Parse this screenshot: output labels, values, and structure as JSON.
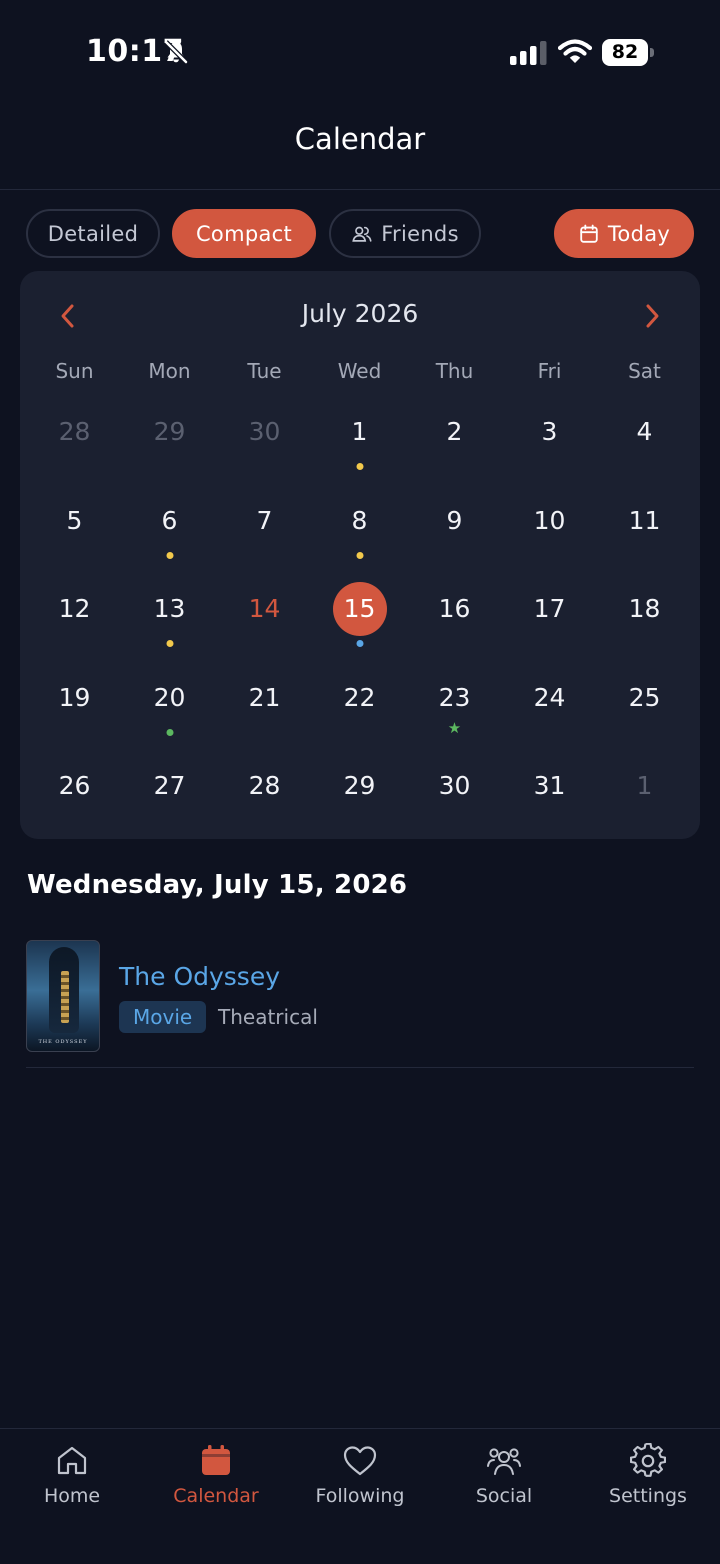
{
  "status_bar": {
    "time": "10:17",
    "battery": "82"
  },
  "header": {
    "title": "Calendar"
  },
  "view_toggle": {
    "detailed": "Detailed",
    "compact": "Compact",
    "friends": "Friends",
    "today": "Today",
    "active": "Compact"
  },
  "calendar": {
    "month_label": "July 2026",
    "weekdays": [
      "Sun",
      "Mon",
      "Tue",
      "Wed",
      "Thu",
      "Fri",
      "Sat"
    ],
    "weeks": [
      [
        {
          "n": "28",
          "muted": true
        },
        {
          "n": "29",
          "muted": true
        },
        {
          "n": "30",
          "muted": true
        },
        {
          "n": "1",
          "marker": "dot-yellow"
        },
        {
          "n": "2"
        },
        {
          "n": "3"
        },
        {
          "n": "4"
        }
      ],
      [
        {
          "n": "5"
        },
        {
          "n": "6",
          "marker": "dot-yellow"
        },
        {
          "n": "7"
        },
        {
          "n": "8",
          "marker": "dot-yellow"
        },
        {
          "n": "9"
        },
        {
          "n": "10"
        },
        {
          "n": "11"
        }
      ],
      [
        {
          "n": "12"
        },
        {
          "n": "13",
          "marker": "dot-yellow"
        },
        {
          "n": "14",
          "today": true
        },
        {
          "n": "15",
          "selected": true,
          "marker": "dot-blue"
        },
        {
          "n": "16"
        },
        {
          "n": "17"
        },
        {
          "n": "18"
        }
      ],
      [
        {
          "n": "19"
        },
        {
          "n": "20",
          "marker": "dot-green"
        },
        {
          "n": "21"
        },
        {
          "n": "22"
        },
        {
          "n": "23",
          "marker": "star-green"
        },
        {
          "n": "24"
        },
        {
          "n": "25"
        }
      ],
      [
        {
          "n": "26"
        },
        {
          "n": "27"
        },
        {
          "n": "28"
        },
        {
          "n": "29"
        },
        {
          "n": "30"
        },
        {
          "n": "31"
        },
        {
          "n": "1",
          "muted": true
        }
      ]
    ],
    "marker_colors": {
      "dot-yellow": "#f2c94c",
      "dot-blue": "#5aa6e6",
      "dot-green": "#5cb860",
      "star-green": "#5cb860"
    }
  },
  "selected_date": {
    "heading": "Wednesday, July 15, 2026"
  },
  "events": [
    {
      "title": "The Odyssey",
      "badge": "Movie",
      "release_type": "Theatrical",
      "poster_text": "THE ODYSSEY"
    }
  ],
  "bottom_nav": {
    "items": [
      {
        "label": "Home",
        "icon": "home-icon"
      },
      {
        "label": "Calendar",
        "icon": "calendar-icon",
        "active": true
      },
      {
        "label": "Following",
        "icon": "heart-icon"
      },
      {
        "label": "Social",
        "icon": "people-icon"
      },
      {
        "label": "Settings",
        "icon": "gear-icon"
      }
    ]
  },
  "colors": {
    "accent": "#d2573f",
    "background": "#0e1220",
    "card": "#1b2030",
    "link": "#5aa6e6"
  }
}
